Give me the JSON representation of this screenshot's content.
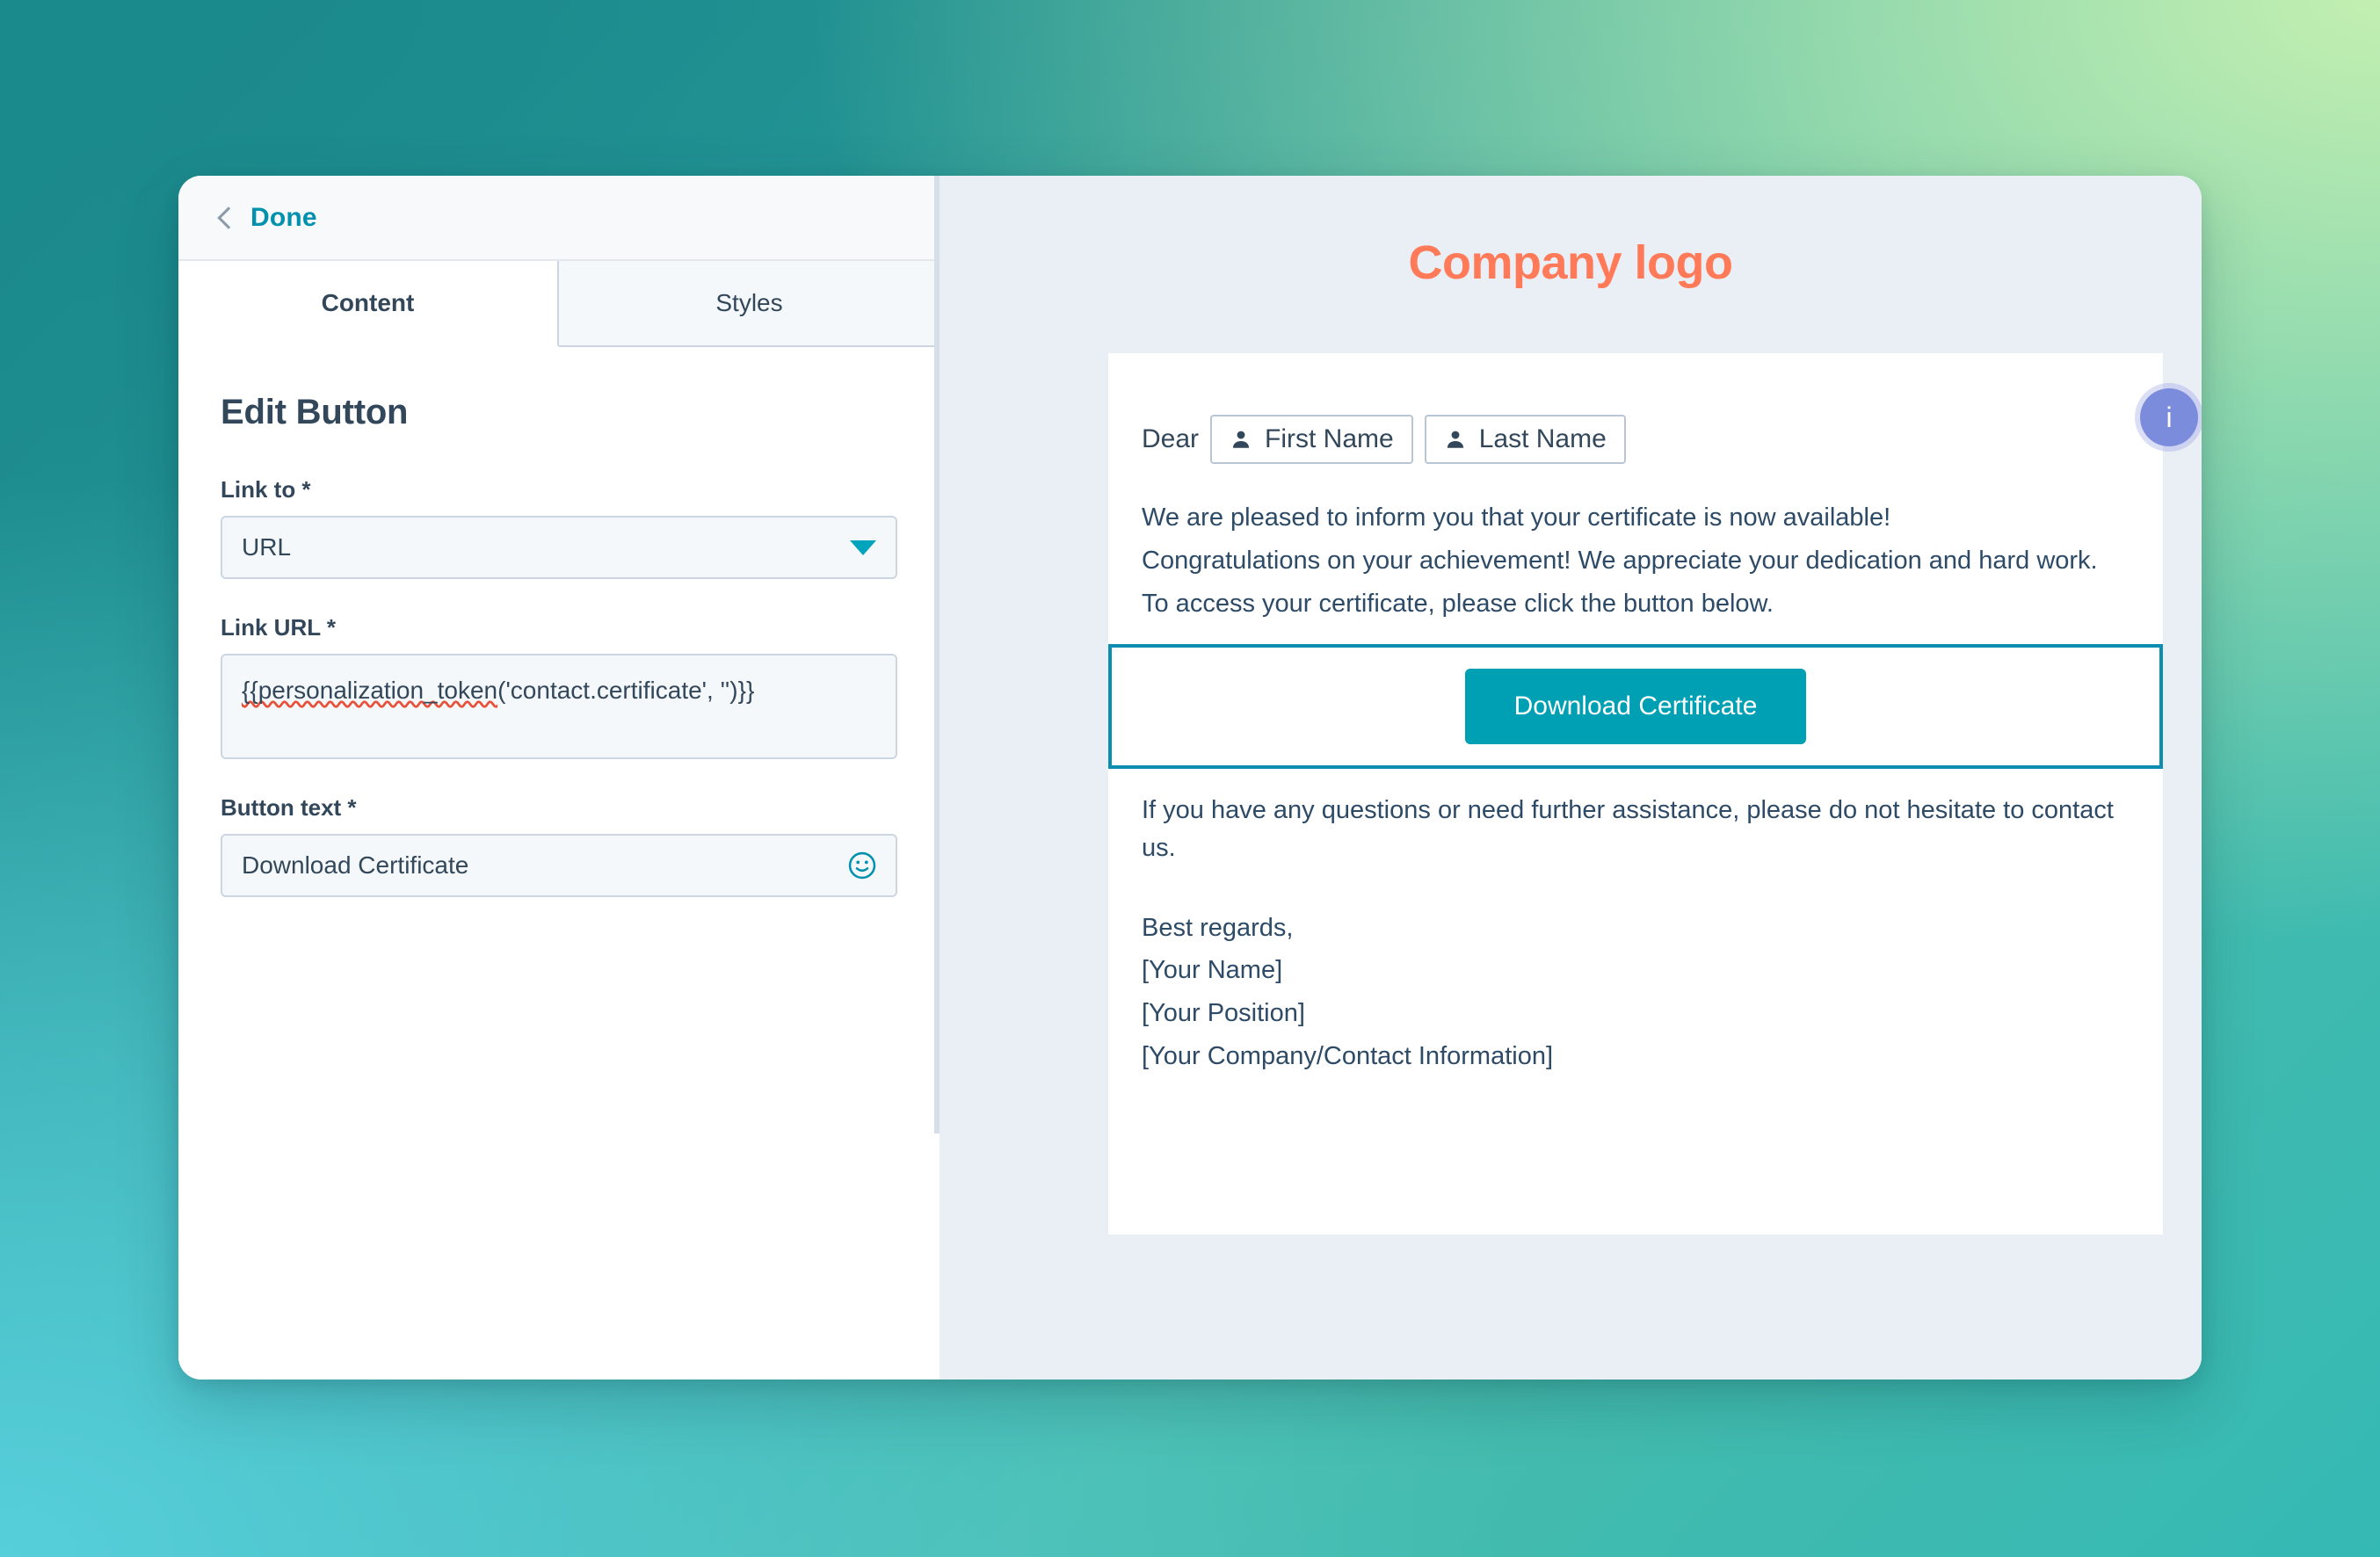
{
  "editor": {
    "back_label": "Done",
    "tabs": [
      {
        "label": "Content",
        "active": true
      },
      {
        "label": "Styles",
        "active": false
      }
    ],
    "panel_title": "Edit Button",
    "fields": {
      "link_to": {
        "label": "Link to *",
        "value": "URL"
      },
      "link_url": {
        "label": "Link URL *",
        "value_misspelled": "{{personalization_token",
        "value_rest": "('contact.certificate', '')}}"
      },
      "button_text": {
        "label": "Button text *",
        "value": "Download Certificate"
      }
    }
  },
  "preview": {
    "logo_text": "Company logo",
    "info_badge": "i",
    "salutation": {
      "prefix": "Dear",
      "tokens": [
        "First Name",
        "Last Name"
      ]
    },
    "body_lines": [
      "We are pleased to inform you that your certificate is now available!",
      "Congratulations on your achievement! We appreciate your dedication and hard work.",
      "To access your certificate, please click the button below."
    ],
    "cta_label": "Download Certificate",
    "closing_lines": [
      "If you have any questions or need further assistance, please do not hesitate to contact us."
    ],
    "signature_lines": [
      "Best regards,",
      "[Your Name]",
      "[Your Position]",
      "[Your Company/Contact Information]"
    ]
  },
  "colors": {
    "accent_teal": "#00a4bd",
    "brand_orange": "#ff7a59",
    "cta_teal": "#00a0b4",
    "selection_outline": "#0d8daf",
    "info_badge_purple": "#7c8cdd",
    "text_navy": "#33475b"
  }
}
